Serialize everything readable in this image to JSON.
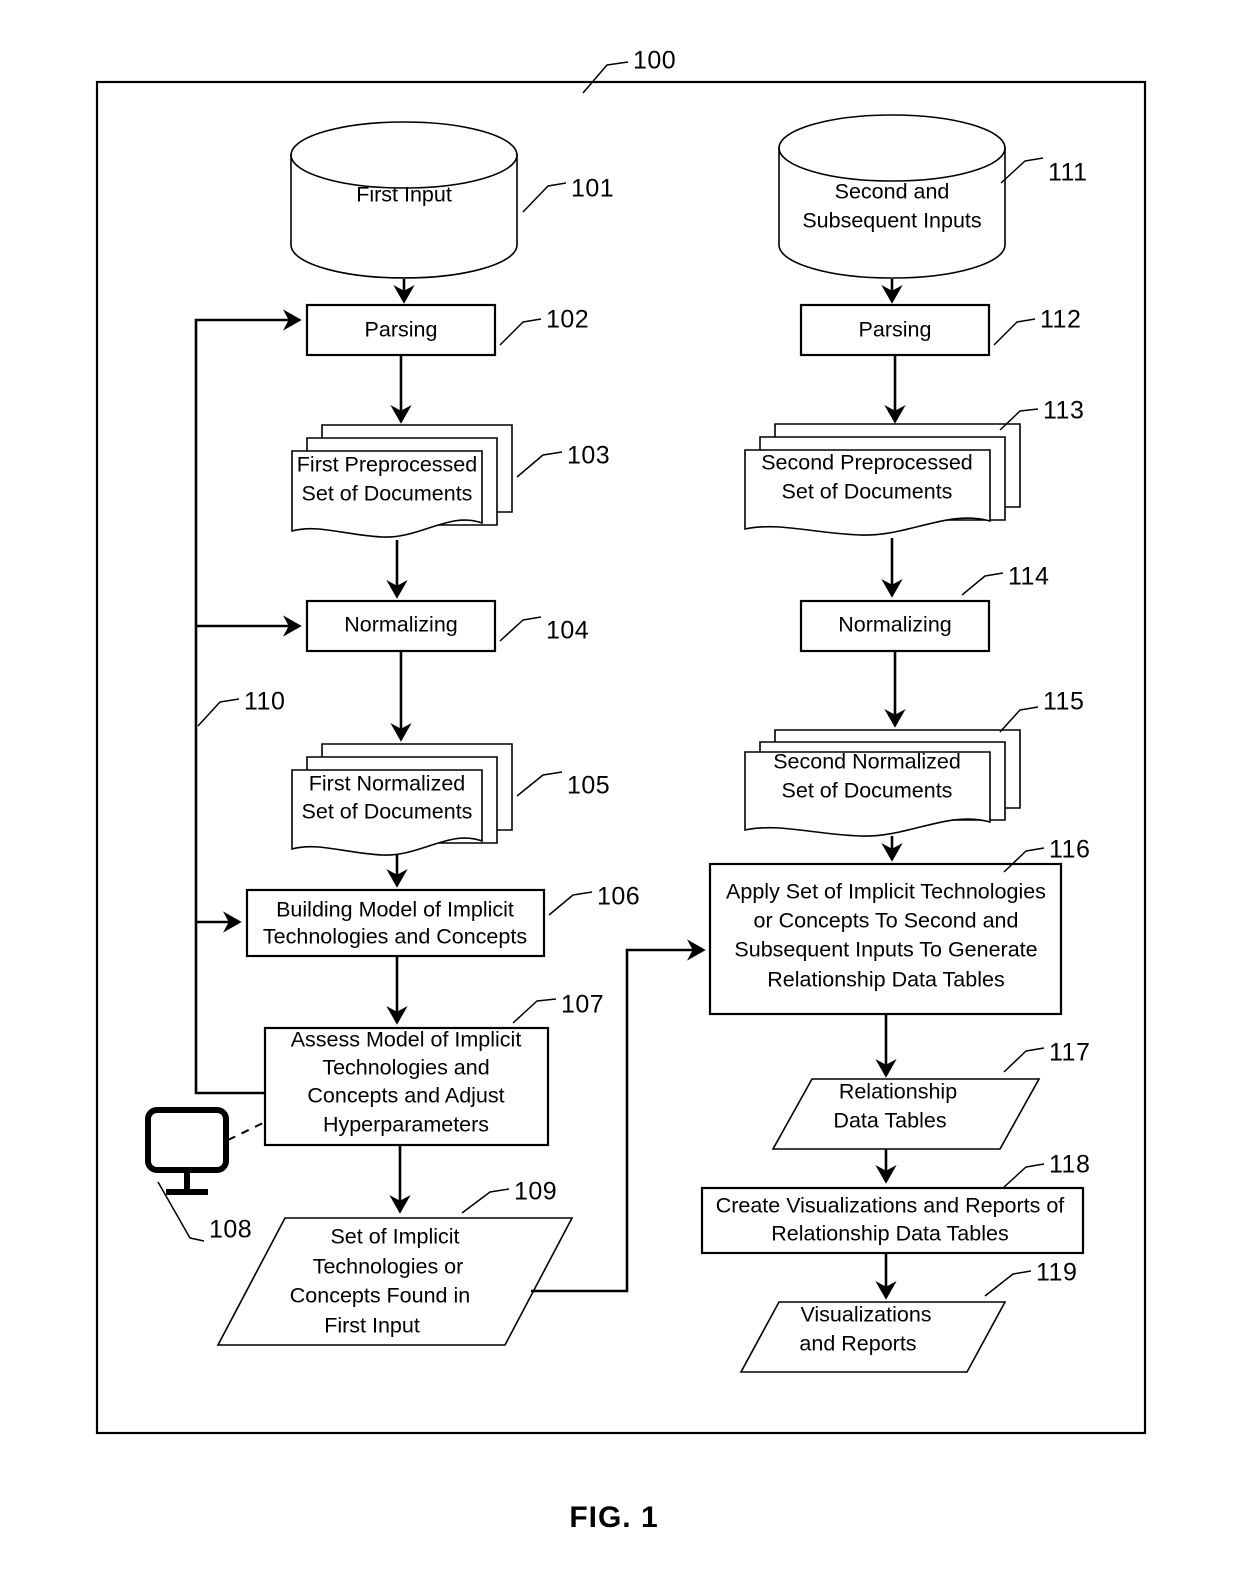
{
  "figure": {
    "caption": "FIG. 1",
    "system_ref": "100"
  },
  "nodes": {
    "n101": {
      "ref": "101",
      "label_lines": [
        "First Input"
      ],
      "shape": "cylinder"
    },
    "n102": {
      "ref": "102",
      "label_lines": [
        "Parsing"
      ],
      "shape": "process"
    },
    "n103": {
      "ref": "103",
      "label_lines": [
        "First Preprocessed",
        "Set of Documents"
      ],
      "shape": "document-stack"
    },
    "n104": {
      "ref": "104",
      "label_lines": [
        "Normalizing"
      ],
      "shape": "process"
    },
    "n105": {
      "ref": "105",
      "label_lines": [
        "First Normalized",
        "Set of Documents"
      ],
      "shape": "document-stack"
    },
    "n106": {
      "ref": "106",
      "label_lines": [
        "Building Model of Implicit",
        "Technologies and Concepts"
      ],
      "shape": "process"
    },
    "n107": {
      "ref": "107",
      "label_lines": [
        "Assess Model of Implicit",
        "Technologies and",
        "Concepts and Adjust",
        "Hyperparameters"
      ],
      "shape": "process"
    },
    "n108": {
      "ref": "108",
      "label_lines": [],
      "shape": "monitor-icon"
    },
    "n109": {
      "ref": "109",
      "label_lines": [
        "Set of Implicit",
        "Technologies or",
        "Concepts Found in",
        "First Input"
      ],
      "shape": "data-parallelogram"
    },
    "n110": {
      "ref": "110",
      "label_lines": [],
      "shape": "feedback-connector"
    },
    "n111": {
      "ref": "111",
      "label_lines": [
        "Second and",
        "Subsequent Inputs"
      ],
      "shape": "cylinder"
    },
    "n112": {
      "ref": "112",
      "label_lines": [
        "Parsing"
      ],
      "shape": "process"
    },
    "n113": {
      "ref": "113",
      "label_lines": [
        "Second Preprocessed",
        "Set of Documents"
      ],
      "shape": "document-stack"
    },
    "n114": {
      "ref": "114",
      "label_lines": [
        "Normalizing"
      ],
      "shape": "process"
    },
    "n115": {
      "ref": "115",
      "label_lines": [
        "Second Normalized",
        "Set of Documents"
      ],
      "shape": "document-stack"
    },
    "n116": {
      "ref": "116",
      "label_lines": [
        "Apply Set of Implicit Technologies",
        "or Concepts To Second and",
        "Subsequent Inputs To Generate",
        "Relationship Data Tables"
      ],
      "shape": "process"
    },
    "n117": {
      "ref": "117",
      "label_lines": [
        "Relationship",
        "Data Tables"
      ],
      "shape": "data-parallelogram"
    },
    "n118": {
      "ref": "118",
      "label_lines": [
        "Create Visualizations and Reports of",
        "Relationship Data Tables"
      ],
      "shape": "process"
    },
    "n119": {
      "ref": "119",
      "label_lines": [
        "Visualizations",
        "and Reports"
      ],
      "shape": "data-parallelogram"
    }
  },
  "colors": {
    "stroke": "#000000",
    "fill": "#ffffff",
    "background": "#ffffff"
  }
}
